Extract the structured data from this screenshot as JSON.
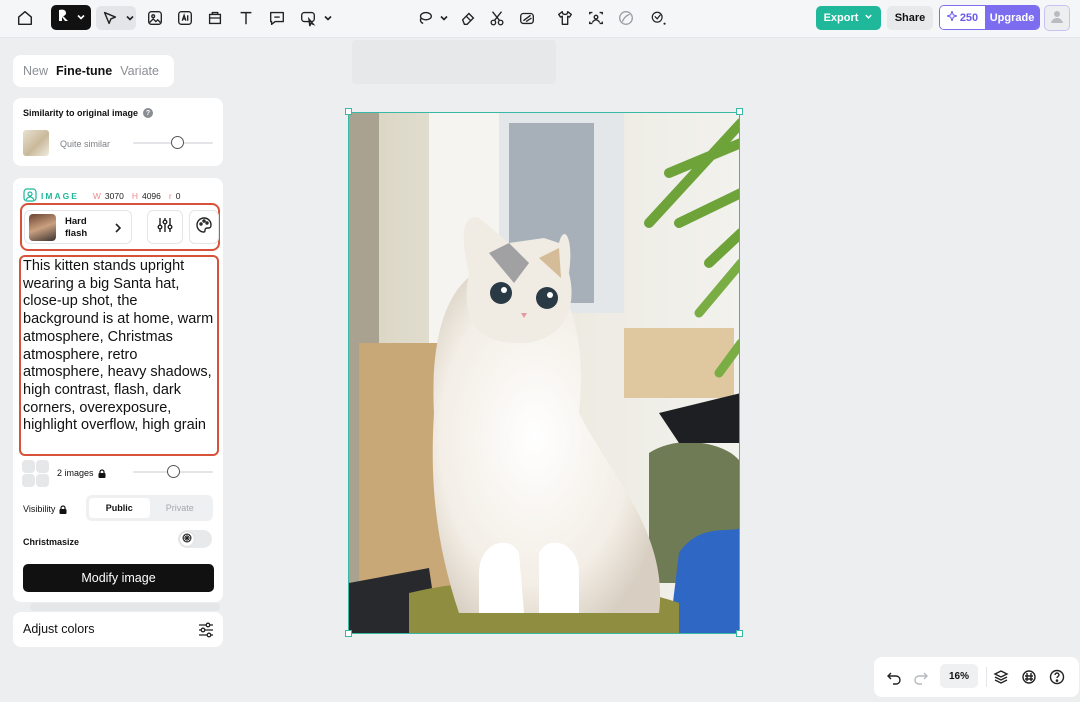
{
  "topbar": {
    "export_label": "Export",
    "share_label": "Share",
    "credits": "250",
    "upgrade_label": "Upgrade"
  },
  "mode_tabs": [
    "New",
    "Fine-tune",
    "Variate"
  ],
  "active_tab": "Fine-tune",
  "similarity": {
    "title": "Similarity to original image",
    "value_label": "Quite similar",
    "level": 0.55
  },
  "image_info": {
    "label": "IMAGE",
    "w_key": "W",
    "width": "3070",
    "h_key": "H",
    "height": "4096",
    "r_key": "r",
    "rotation": "0"
  },
  "style": {
    "name": "Hard flash"
  },
  "prompt": "This kitten stands upright wearing a big Santa hat, close-up shot, the background is at home, warm atmosphere, Christmas atmosphere, retro atmosphere, heavy shadows, high contrast, flash, dark corners, overexposure, highlight overflow, high grain",
  "images": {
    "label": "2 images",
    "level": 0.5
  },
  "visibility": {
    "label": "Visibility",
    "options": [
      "Public",
      "Private"
    ],
    "selected": "Public"
  },
  "christmasize": {
    "label": "Christmasize",
    "enabled": false
  },
  "modify_label": "Modify image",
  "adjust_label": "Adjust colors",
  "zoom": "16%",
  "colors": {
    "accent_green": "#1fb89a",
    "upgrade_purple": "#7b6cf0",
    "highlight_red": "#d7523a",
    "selection": "#38b9a6"
  }
}
